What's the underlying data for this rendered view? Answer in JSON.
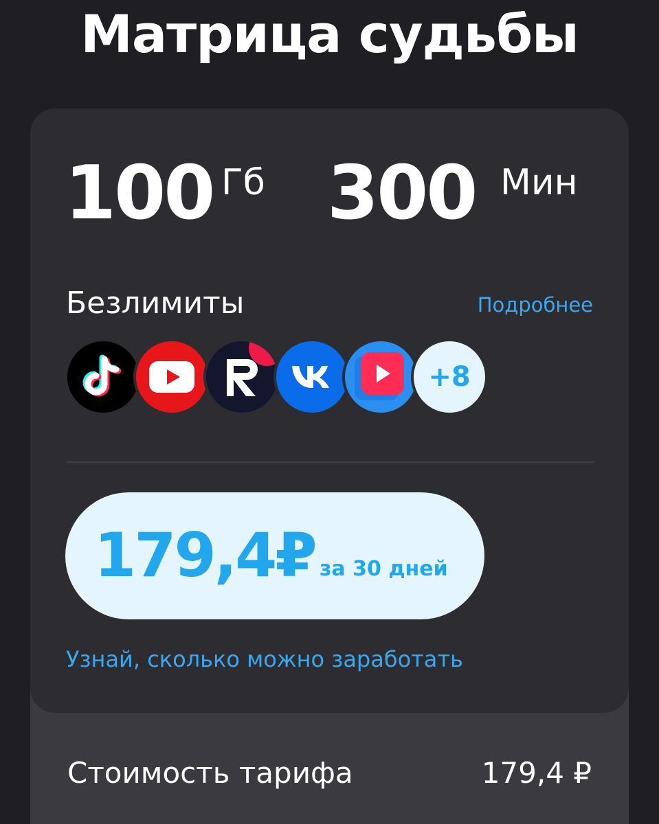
{
  "page": {
    "title": "Матрица судьбы"
  },
  "tariff": {
    "internet_amount": "100",
    "internet_unit": "Гб",
    "minutes_amount": "300",
    "minutes_unit": "Мин"
  },
  "unlimited": {
    "label": "Безлимиты",
    "details_link": "Подробнее",
    "services": [
      {
        "icon": "tiktok-icon"
      },
      {
        "icon": "youtube-icon"
      },
      {
        "icon": "rutube-icon"
      },
      {
        "icon": "vk-icon"
      },
      {
        "icon": "vk-video-icon"
      }
    ],
    "more_count": "+8"
  },
  "price": {
    "amount": "179,4₽",
    "period": "за 30 дней"
  },
  "earn_link": "Узнай, сколько можно заработать",
  "cost": {
    "label": "Стоимость тарифа",
    "value": "179,4 ₽"
  },
  "colors": {
    "background": "#1f1f23",
    "card": "#2c2c31",
    "accent": "#22a6ec",
    "pill": "#e4f5fd",
    "panel": "#3a3a40"
  }
}
